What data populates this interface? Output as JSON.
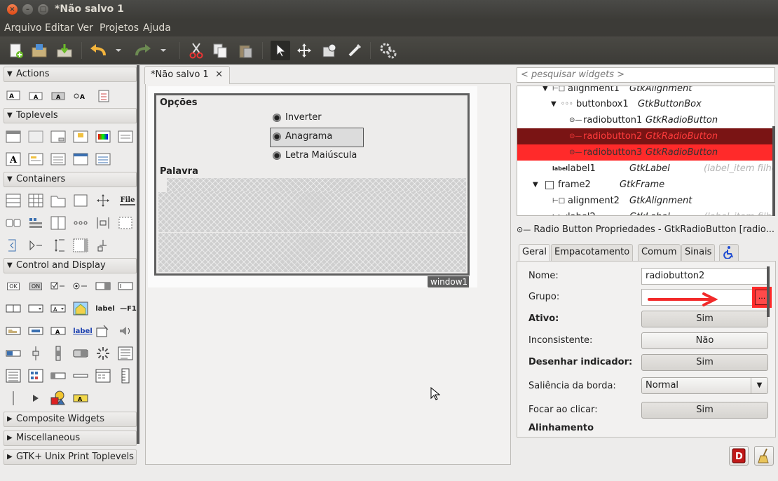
{
  "window": {
    "title": "*Não salvo 1"
  },
  "menu": [
    "Arquivo",
    "Editar",
    "Ver",
    "Projetos",
    "Ajuda"
  ],
  "toolbar": [
    "new-icon",
    "open-icon",
    "save-icon",
    "undo-icon",
    "undo-dropdown-icon",
    "redo-icon",
    "redo-dropdown-icon",
    "cut-icon",
    "copy-icon",
    "paste-icon",
    "select-pointer-icon",
    "drag-resize-icon",
    "widget-window-icon",
    "edit-icon",
    "preferences-icon"
  ],
  "palette": {
    "groups": [
      {
        "label": "Actions",
        "expanded": true
      },
      {
        "label": "Toplevels",
        "expanded": true
      },
      {
        "label": "Containers",
        "expanded": true
      },
      {
        "label": "Control and Display",
        "expanded": true
      },
      {
        "label": "Composite Widgets",
        "expanded": false
      },
      {
        "label": "Miscellaneous",
        "expanded": false
      },
      {
        "label": "GTK+ Unix Print Toplevels",
        "expanded": false
      }
    ],
    "icon_text": {
      "file": "File",
      "ok": "OK",
      "on": "ON",
      "label": "label",
      "f1": "F1",
      "label2": "label"
    }
  },
  "editor": {
    "tab_label": "*Não salvo 1",
    "frame1_title": "Opções",
    "radio_labels": [
      "Inverter",
      "Anagrama",
      "Letra Maiúscula"
    ],
    "frame2_title": "Palavra",
    "window_label": "window1"
  },
  "search": {
    "placeholder": "< pesquisar widgets >"
  },
  "tree": {
    "rows": [
      {
        "name": "alignment1",
        "cls": "GtkAlignment",
        "extra": ""
      },
      {
        "name": "buttonbox1",
        "cls": "GtkButtonBox",
        "extra": ""
      },
      {
        "name": "radiobutton1",
        "cls": "GtkRadioButton",
        "extra": ""
      },
      {
        "name": "radiobutton2",
        "cls": "GtkRadioButton",
        "extra": ""
      },
      {
        "name": "radiobutton3",
        "cls": "GtkRadioButton",
        "extra": ""
      },
      {
        "name": "label1",
        "cls": "GtkLabel",
        "extra": "(label_item filho"
      },
      {
        "name": "frame2",
        "cls": "GtkFrame",
        "extra": ""
      },
      {
        "name": "alignment2",
        "cls": "GtkAlignment",
        "extra": ""
      },
      {
        "name": "label2",
        "cls": "GtkLabel",
        "extra": "(label_item filho"
      }
    ],
    "icon_label": "label"
  },
  "properties": {
    "title": "Radio Button Propriedades - GtkRadioButton [radio...",
    "tabs": [
      "Geral",
      "Empacotamento",
      "Comum",
      "Sinais"
    ],
    "rows": [
      {
        "label": "Nome:",
        "value": "radiobutton2",
        "bold": false
      },
      {
        "label": "Grupo:",
        "value": "",
        "bold": false
      },
      {
        "label": "Ativo:",
        "value": "Sim",
        "bold": true
      },
      {
        "label": "Inconsistente:",
        "value": "Não",
        "bold": false
      },
      {
        "label": "Desenhar indicador:",
        "value": "Sim",
        "bold": true
      },
      {
        "label": "Saliência da borda:",
        "value": "Normal",
        "bold": false
      },
      {
        "label": "Focar ao clicar:",
        "value": "Sim",
        "bold": false
      },
      {
        "label": "Alinhamento",
        "value": "",
        "bold": true
      }
    ],
    "group_button": "...",
    "colors": {
      "highlight_red": "#ff2a2a",
      "selected_dark": "#7a1414",
      "arrow_red": "#f22a2a"
    }
  }
}
